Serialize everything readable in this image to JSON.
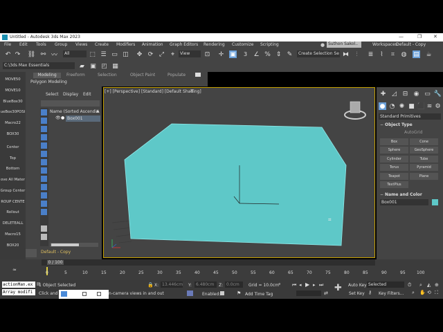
{
  "window": {
    "title": "Untitled - Autodesk 3ds Max 2023",
    "user": "Suthon Sakol..",
    "workspaces_label": "Workspaces:",
    "workspace_value": "Default - Copy"
  },
  "menu": [
    "File",
    "Edit",
    "Tools",
    "Group",
    "Views",
    "Create",
    "Modifiers",
    "Animation",
    "Graph Editors",
    "Rendering",
    "Customize",
    "Scripting"
  ],
  "toolbar": {
    "selection_filter": "All",
    "ref_coord": "View",
    "create_selection_set": "Create Selection Se",
    "project_path": "C:\\3ds Max Essentials"
  },
  "ribbon": {
    "tabs": [
      "Modeling",
      "Freeform",
      "Selection",
      "Object Paint",
      "Populate"
    ],
    "subtitle": "Polygon Modeling"
  },
  "left_buttons": [
    "MOVE50",
    "MOVE10",
    "BlueBox30",
    "ueBox30POSI",
    "Macro22",
    "BOX30",
    "Center",
    "Top",
    "Bottom",
    "ove All Mater",
    "Group Center",
    "ROUP CENTE",
    "Rollout",
    "DELETEALL",
    "Macro15",
    "BOX20"
  ],
  "scene_explorer": {
    "tabs": [
      "Select",
      "Display",
      "Edit"
    ],
    "column_header": "Name (Sorted Ascending)",
    "items": [
      "Box001"
    ],
    "layer": "Default - Copy"
  },
  "viewport": {
    "label": "[+] [Perspective] [Standard] [Default Shading]",
    "box_color": "#5ec8c8"
  },
  "command_panel": {
    "category": "Standard Primitives",
    "object_type_header": "Object Type",
    "autogrid": "AutoGrid",
    "buttons": [
      "Box",
      "Cone",
      "Sphere",
      "GeoSphere",
      "Cylinder",
      "Tube",
      "Torus",
      "Pyramid",
      "Teapot",
      "Plane",
      "TextPlus"
    ],
    "name_color_header": "Name and Color",
    "object_name": "Box001",
    "object_color": "#5ec8c8"
  },
  "timeline": {
    "frame_counter": "0 / 100",
    "ticks": [
      "0",
      "5",
      "10",
      "15",
      "20",
      "25",
      "30",
      "35",
      "40",
      "45",
      "50",
      "55",
      "60",
      "65",
      "70",
      "75",
      "80",
      "85",
      "90",
      "95",
      "100"
    ]
  },
  "status": {
    "script_line1": "actionMan.ex",
    "script_line2": "Array modifi",
    "selection": "1 Object Selected",
    "prompt": "Click and d",
    "prompt_tail": "n-camera views in and out",
    "x_label": "X:",
    "x_value": "13.446cm",
    "y_label": "Y:",
    "y_value": "6.480cm",
    "z_label": "Z:",
    "z_value": "0.0cm",
    "grid": "Grid = 10.0cm",
    "enabled": "Enabled:",
    "add_time_tag": "Add Time Tag",
    "auto_key": "Auto Key",
    "set_key": "Set Key",
    "selected": "Selected",
    "key_filters": "Key Filters..."
  }
}
